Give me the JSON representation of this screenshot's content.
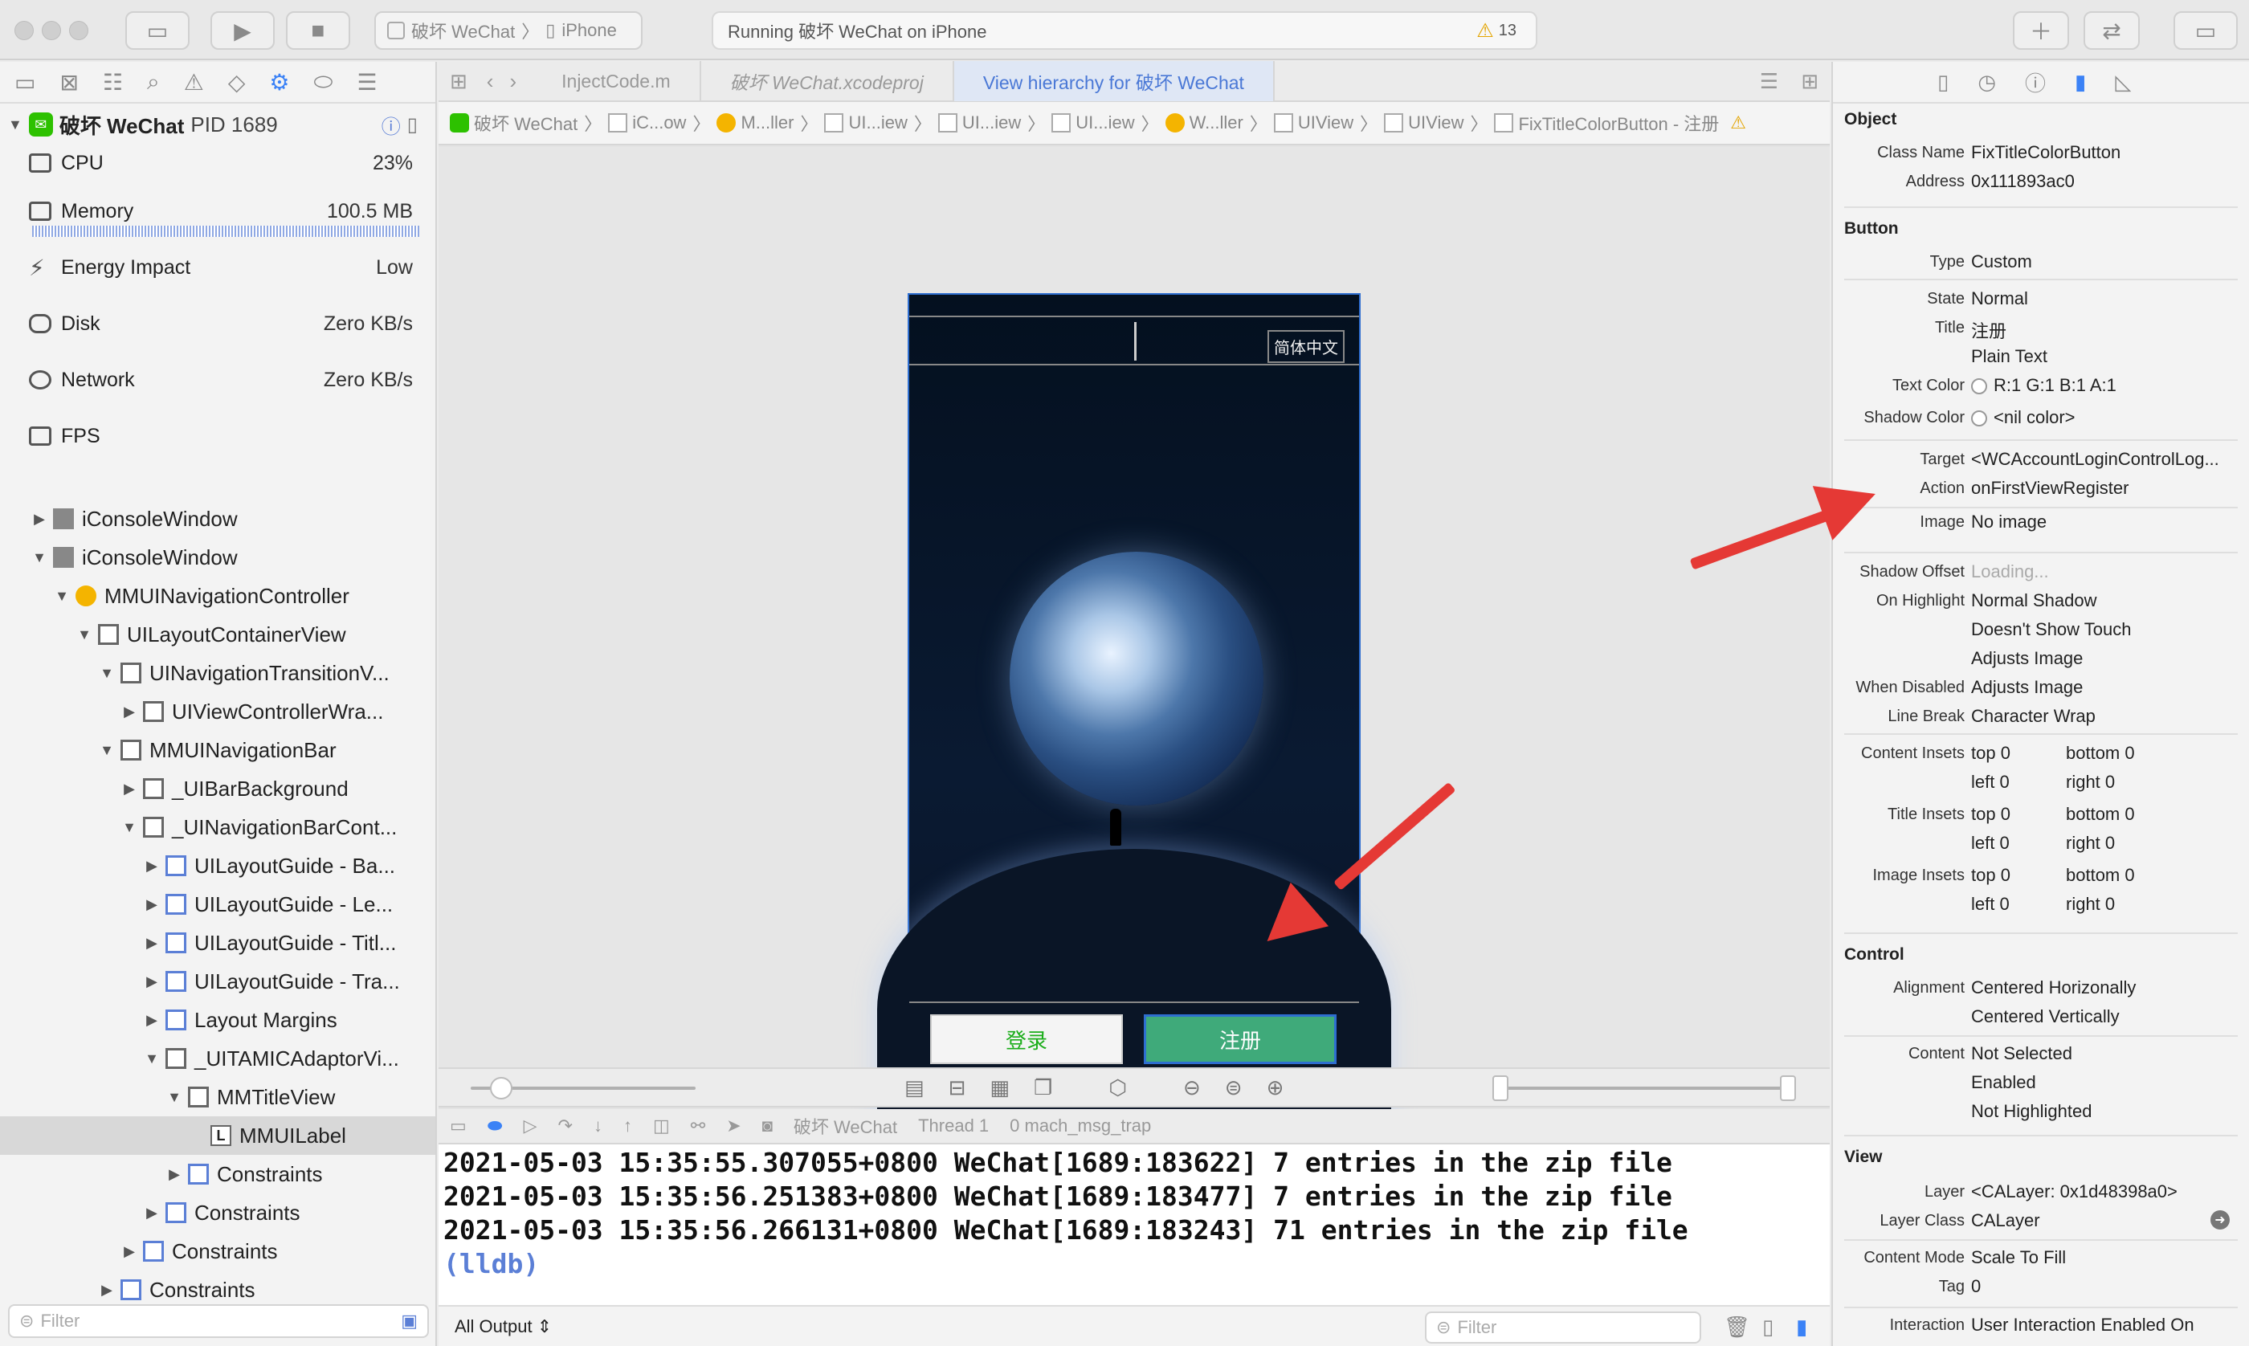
{
  "toolbar": {
    "scheme_app": "破坏 WeChat",
    "scheme_device": "iPhone",
    "status": "Running 破坏 WeChat on iPhone",
    "warnings": "13"
  },
  "tabs": [
    {
      "label": "InjectCode.m"
    },
    {
      "label": "破坏 WeChat.xcodeproj"
    },
    {
      "label": "View hierarchy for 破坏 WeChat"
    }
  ],
  "breadcrumbs": [
    "破坏 WeChat",
    "iC...ow",
    "M...ller",
    "UI...iew",
    "UI...iew",
    "UI...iew",
    "W...ller",
    "UIView",
    "UIView",
    "FixTitleColorButton - 注册"
  ],
  "process": {
    "name": "破坏 WeChat",
    "pid": "PID 1689"
  },
  "gauges": [
    {
      "label": "CPU",
      "value": "23%"
    },
    {
      "label": "Memory",
      "value": "100.5 MB"
    },
    {
      "label": "Energy Impact",
      "value": "Low"
    },
    {
      "label": "Disk",
      "value": "Zero KB/s"
    },
    {
      "label": "Network",
      "value": "Zero KB/s"
    },
    {
      "label": "FPS",
      "value": ""
    }
  ],
  "tree": [
    {
      "label": "iConsoleWindow",
      "tri": "▶"
    },
    {
      "label": "iConsoleWindow",
      "tri": "▼"
    },
    {
      "label": "MMUINavigationController",
      "tri": "▼"
    },
    {
      "label": "UILayoutContainerView",
      "tri": "▼"
    },
    {
      "label": "UINavigationTransitionV...",
      "tri": "▼"
    },
    {
      "label": "UIViewControllerWra...",
      "tri": "▶"
    },
    {
      "label": "MMUINavigationBar",
      "tri": "▼"
    },
    {
      "label": "_UIBarBackground",
      "tri": "▶"
    },
    {
      "label": "_UINavigationBarCont...",
      "tri": "▼"
    },
    {
      "label": "UILayoutGuide - Ba...",
      "tri": "▶"
    },
    {
      "label": "UILayoutGuide - Le...",
      "tri": "▶"
    },
    {
      "label": "UILayoutGuide - Titl...",
      "tri": "▶"
    },
    {
      "label": "UILayoutGuide - Tra...",
      "tri": "▶"
    },
    {
      "label": "Layout Margins",
      "tri": "▶"
    },
    {
      "label": "_UITAMICAdaptorVi...",
      "tri": "▼"
    },
    {
      "label": "MMTitleView",
      "tri": "▼"
    },
    {
      "label": "MMUILabel",
      "tri": ""
    },
    {
      "label": "Constraints",
      "tri": "▶"
    },
    {
      "label": "Constraints",
      "tri": "▶"
    },
    {
      "label": "Constraints",
      "tri": "▶"
    },
    {
      "label": "Constraints",
      "tri": "▶"
    }
  ],
  "left_filter": "Filter",
  "phone": {
    "lang": "简体中文",
    "login": "登录",
    "register": "注册"
  },
  "debug": {
    "app": "破坏 WeChat",
    "thread": "Thread 1",
    "frame": "0 mach_msg_trap"
  },
  "console": {
    "lines": [
      "2021-05-03 15:35:55.307055+0800 WeChat[1689:183622] 7 entries in the zip file",
      "2021-05-03 15:35:56.251383+0800 WeChat[1689:183477] 7 entries in the zip file",
      "2021-05-03 15:35:56.266131+0800 WeChat[1689:183243] 71 entries in the zip file"
    ],
    "prompt": "(lldb)",
    "output_select": "All Output",
    "filter": "Filter"
  },
  "inspector": {
    "object": {
      "title": "Object",
      "class_label": "Class Name",
      "class": "FixTitleColorButton",
      "addr_label": "Address",
      "addr": "0x111893ac0"
    },
    "button": {
      "title": "Button",
      "type_label": "Type",
      "type": "Custom",
      "state_label": "State",
      "state": "Normal",
      "title_label": "Title",
      "title_value": "注册",
      "title_kind": "Plain Text",
      "tc_label": "Text Color",
      "tc": "R:1 G:1 B:1 A:1",
      "sc_label": "Shadow Color",
      "sc": "<nil color>",
      "target_label": "Target",
      "target": "<WCAccountLoginControlLog...",
      "action_label": "Action",
      "action": "onFirstViewRegister",
      "image_label": "Image",
      "image": "No image",
      "so_label": "Shadow Offset",
      "so": "Loading...",
      "oh_label": "On Highlight",
      "oh1": "Normal Shadow",
      "oh2": "Doesn't Show Touch",
      "oh3": "Adjusts Image",
      "wd_label": "When Disabled",
      "wd": "Adjusts Image",
      "lb_label": "Line Break",
      "lb": "Character Wrap",
      "ci_label": "Content Insets",
      "ti_label": "Title Insets",
      "ii_label": "Image Insets",
      "top": "top",
      "bottom": "bottom",
      "left": "left",
      "right": "right",
      "zero": "0"
    },
    "control": {
      "title": "Control",
      "al_label": "Alignment",
      "al1": "Centered Horizonally",
      "al2": "Centered Vertically",
      "ct_label": "Content",
      "ct1": "Not Selected",
      "ct2": "Enabled",
      "ct3": "Not Highlighted"
    },
    "view": {
      "title": "View",
      "layer_label": "Layer",
      "layer": "<CALayer: 0x1d48398a0>",
      "lc_label": "Layer Class",
      "lc": "CALayer",
      "cm_label": "Content Mode",
      "cm": "Scale To Fill",
      "tag_label": "Tag",
      "tag": "0",
      "int_label": "Interaction",
      "int": "User Interaction Enabled On"
    }
  },
  "colors": {
    "accent": "#3b82f6",
    "wechat_green": "#2dc100",
    "register_green": "#3faa7a",
    "arrow_red": "#e53935"
  }
}
